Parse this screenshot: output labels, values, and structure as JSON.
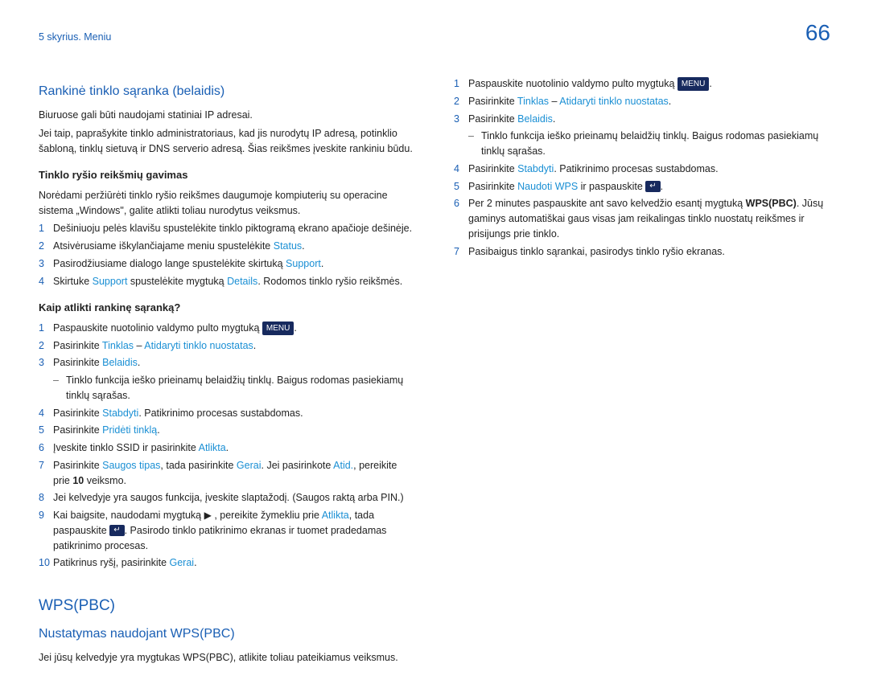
{
  "header": {
    "chapter": "5 skyrius. Meniu",
    "page": "66"
  },
  "col1": {
    "h1": "Rankinė tinklo sąranka (belaidis)",
    "p1": "Biuruose gali būti naudojami statiniai IP adresai.",
    "p2": "Jei taip, paprašykite tinklo administratoriaus, kad jis nurodytų IP adresą, potinklio šabloną, tinklų sietuvą ir DNS serverio adresą. Šias reikšmes įveskite rankiniu būdu.",
    "h2": "Tinklo ryšio reikšmių gavimas",
    "p3": "Norėdami peržiūrėti tinklo ryšio reikšmes daugumoje kompiuterių su operacine sistema „Windows\", galite atlikti toliau nurodytus veiksmus.",
    "a1": "Dešiniuoju pelės klavišu spustelėkite tinklo piktogramą ekrano apačioje dešinėje.",
    "a2a": "Atsivėrusiame iškylančiajame meniu spustelėkite ",
    "a2b": "Status",
    "a3a": "Pasirodžiusiame dialogo lange spustelėkite skirtuką ",
    "a3b": "Support",
    "a4a": "Skirtuke ",
    "a4b": "Support",
    "a4c": " spustelėkite mygtuką ",
    "a4d": "Details",
    "a4e": ". Rodomos tinklo ryšio reikšmės.",
    "h3": "Kaip atlikti rankinę sąranką?",
    "b1a": "Paspauskite nuotolinio valdymo pulto mygtuką ",
    "b1_badge": "MENU",
    "b2a": "Pasirinkite ",
    "b2b": "Tinklas",
    "b2c": " – ",
    "b2d": "Atidaryti tinklo nuostatas",
    "b3a": "Pasirinkite ",
    "b3b": "Belaidis",
    "bdash": "Tinklo funkcija ieško prieinamų belaidžių tinklų. Baigus rodomas pasiekiamų tinklų sąrašas.",
    "b4a": "Pasirinkite ",
    "b4b": "Stabdyti",
    "b4c": ". Patikrinimo procesas sustabdomas.",
    "b5a": "Pasirinkite ",
    "b5b": "Pridėti tinklą",
    "b6a": "Įveskite tinklo SSID ir pasirinkite ",
    "b6b": "Atlikta",
    "b7a": "Pasirinkite ",
    "b7b": "Saugos tipas",
    "b7c": ", tada pasirinkite ",
    "b7d": "Gerai",
    "b7e": ". Jei pasirinkote ",
    "b7f": "Atid.",
    "b7g": ", pereikite prie ",
    "b7h": "10",
    "b7i": " veiksmo.",
    "b8": "Jei kelvedyje yra saugos funkcija, įveskite slaptažodį. (Saugos raktą arba PIN.)",
    "b9a": "Kai baigsite, naudodami mygtuką ",
    "b9b": " , pereikite žymekliu prie ",
    "b9c": "Atlikta",
    "b9d": ", tada paspauskite ",
    "b9e": "Pasirodo tinklo patikrinimo ekranas ir tuomet pradedamas patikrinimo procesas.",
    "b10a": "Patikrinus ryšį, pasirinkite ",
    "b10b": "Gerai",
    "wps_h1": "WPS(PBC)",
    "wps_h2": "Nustatymas naudojant WPS(PBC)",
    "wps_p": "Jei jūsų kelvedyje yra mygtukas WPS(PBC), atlikite toliau pateikiamus veiksmus."
  },
  "col2": {
    "c1a": "Paspauskite nuotolinio valdymo pulto mygtuką ",
    "c1_badge": "MENU",
    "c2a": "Pasirinkite ",
    "c2b": "Tinklas",
    "c2c": " – ",
    "c2d": "Atidaryti tinklo nuostatas",
    "c3a": "Pasirinkite ",
    "c3b": "Belaidis",
    "cdash": "Tinklo funkcija ieško prieinamų belaidžių tinklų. Baigus rodomas pasiekiamų tinklų sąrašas.",
    "c4a": "Pasirinkite ",
    "c4b": "Stabdyti",
    "c4c": ". Patikrinimo procesas sustabdomas.",
    "c5a": "Pasirinkite ",
    "c5b": "Naudoti WPS",
    "c5c": " ir paspauskite ",
    "c6a": "Per 2 minutes paspauskite ant savo kelvedžio esantį mygtuką ",
    "c6b": "WPS(PBC)",
    "c6c": ". Jūsų gaminys automatiškai gaus visas jam reikalingas tinklo nuostatų reikšmes ir prisijungs prie tinklo.",
    "c7": "Pasibaigus tinklo sąrankai, pasirodys tinklo ryšio ekranas."
  }
}
